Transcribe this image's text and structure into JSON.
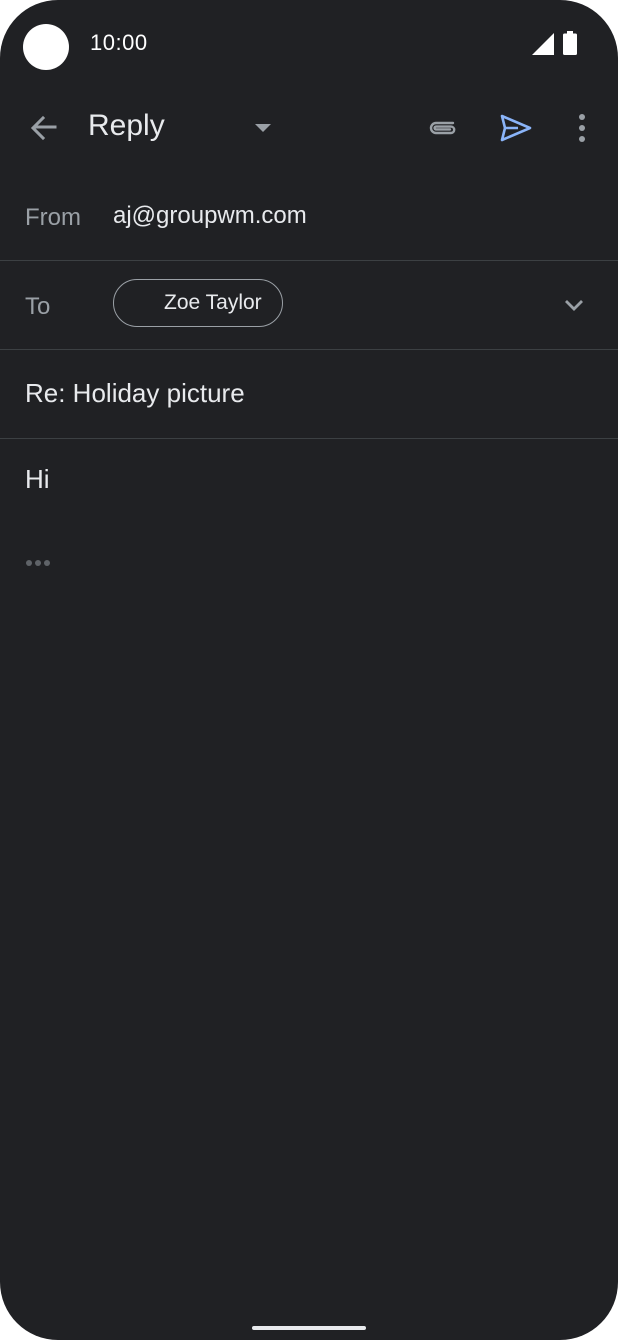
{
  "status_bar": {
    "time": "10:00",
    "signal_icon": "cellular-signal-icon",
    "battery_icon": "battery-icon"
  },
  "app_bar": {
    "title": "Reply",
    "back_icon": "back-arrow-icon",
    "dropdown_icon": "dropdown-triangle-icon",
    "attach_icon": "attachment-icon",
    "send_icon": "send-icon",
    "more_icon": "more-vert-icon"
  },
  "compose": {
    "from_label": "From",
    "from_value": "aj@groupwm.com",
    "to_label": "To",
    "recipients": [
      {
        "name": "Zoe Taylor"
      }
    ],
    "subject": "Re: Holiday picture",
    "body": "Hi"
  },
  "colors": {
    "background": "#202124",
    "text_primary": "#e8eaed",
    "text_secondary": "#9aa0a6",
    "divider": "#3c4043",
    "accent_send": "#8ab4f8"
  }
}
